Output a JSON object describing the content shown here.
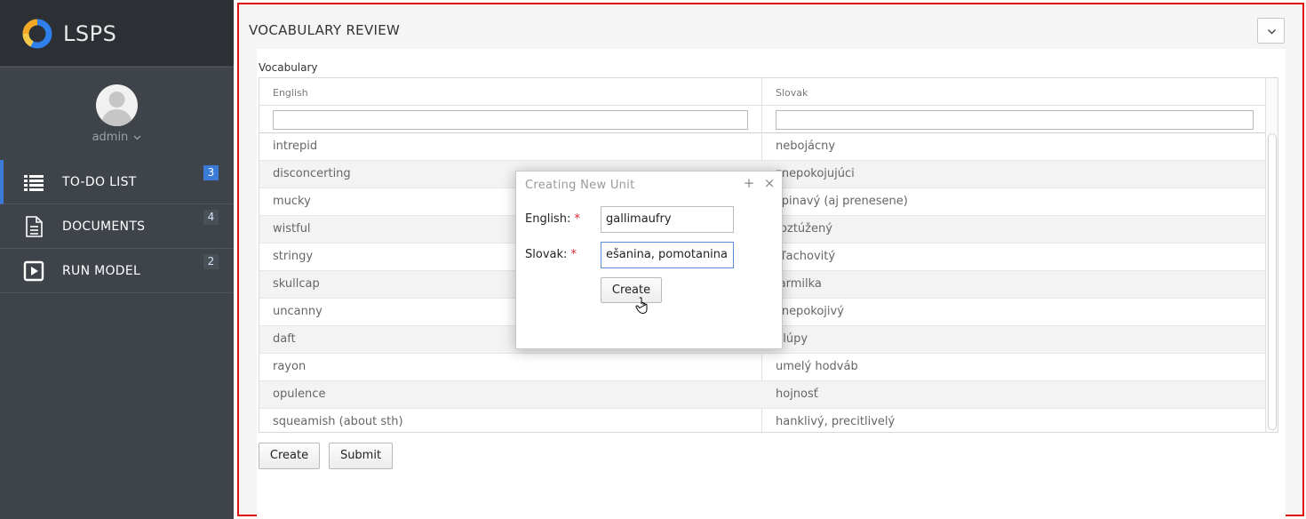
{
  "app": {
    "name": "LSPS"
  },
  "user": {
    "name": "admin"
  },
  "nav": [
    {
      "label": "TO-DO LIST",
      "badge": "3",
      "icon": "list-icon"
    },
    {
      "label": "DOCUMENTS",
      "badge": "4",
      "icon": "document-icon"
    },
    {
      "label": "RUN MODEL",
      "badge": "2",
      "icon": "play-icon"
    }
  ],
  "panel": {
    "title": "VOCABULARY REVIEW",
    "collapse_icon": "chevron-down-icon"
  },
  "vocabulary": {
    "label": "Vocabulary",
    "columns": [
      "English",
      "Slovak"
    ],
    "filters": [
      "",
      ""
    ],
    "rows": [
      [
        "intrepid",
        "nebojácny"
      ],
      [
        "disconcerting",
        "znepokojujúci"
      ],
      [
        "mucky",
        "špinavý (aj prenesene)"
      ],
      [
        "wistful",
        "roztúžený"
      ],
      [
        "stringy",
        "šľachovitý"
      ],
      [
        "skullcap",
        "jarmilka"
      ],
      [
        "uncanny",
        "znepokojivý"
      ],
      [
        "daft",
        "hlúpy"
      ],
      [
        "rayon",
        "umelý hodváb"
      ],
      [
        "opulence",
        "hojnosť"
      ],
      [
        "squeamish (about sth)",
        "hanklivý, precitlivelý"
      ]
    ]
  },
  "actions": {
    "create": "Create",
    "submit": "Submit"
  },
  "dialog": {
    "title": "Creating New Unit",
    "english_label": "English:",
    "slovak_label": "Slovak:",
    "required_mark": "*",
    "english_value": "gallimaufry",
    "slovak_value": "ešanina, pomotanina",
    "create": "Create",
    "maximize_glyph": "+",
    "close_glyph": "×"
  },
  "colors": {
    "accent": "#3a7bd5",
    "highlight_border": "#e01010",
    "sidebar": "#3f444a"
  }
}
